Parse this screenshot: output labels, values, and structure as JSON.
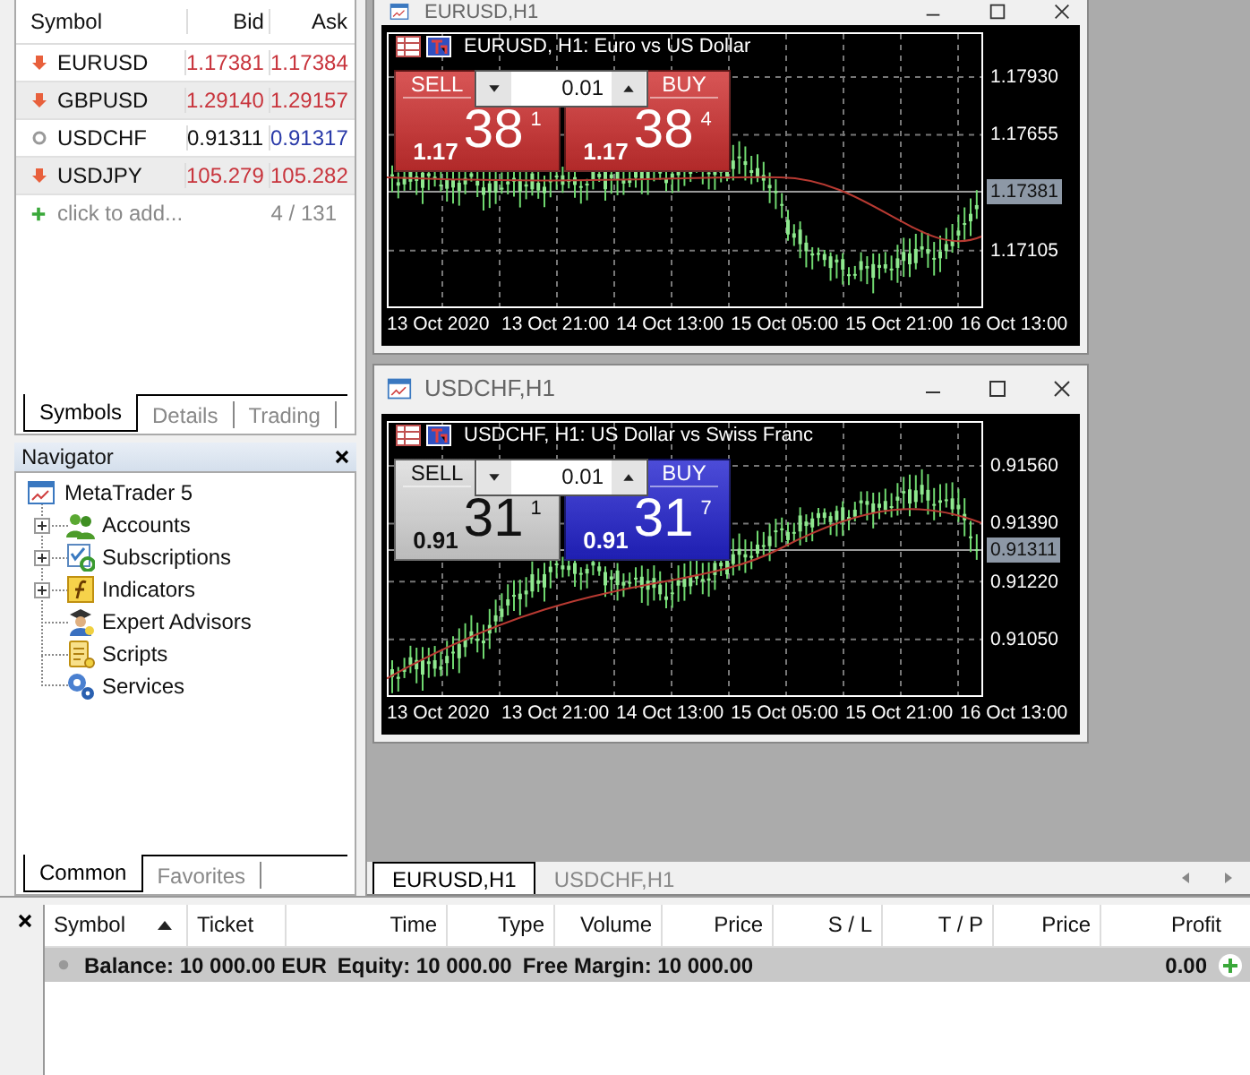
{
  "market_watch": {
    "columns": [
      "Symbol",
      "Bid",
      "Ask"
    ],
    "rows": [
      {
        "symbol": "EURUSD",
        "falling": true,
        "bid": {
          "value": "1.17381",
          "color": "#c8343c"
        },
        "ask": {
          "value": "1.17384",
          "color": "#c8343c"
        }
      },
      {
        "symbol": "GBPUSD",
        "falling": true,
        "bid": {
          "value": "1.29140",
          "color": "#c8343c"
        },
        "ask": {
          "value": "1.29157",
          "color": "#c8343c"
        }
      },
      {
        "symbol": "USDCHF",
        "falling": false,
        "bid": {
          "value": "0.91311",
          "color": "#111111"
        },
        "ask": {
          "value": "0.91317",
          "color": "#2a3aa8"
        }
      },
      {
        "symbol": "USDJPY",
        "falling": true,
        "bid": {
          "value": "105.279",
          "color": "#c8343c"
        },
        "ask": {
          "value": "105.282",
          "color": "#c8343c"
        }
      }
    ],
    "add_row": {
      "label": "click to add...",
      "count": "4 / 131"
    },
    "tabs": [
      {
        "label": "Symbols",
        "selected": true
      },
      {
        "label": "Details",
        "selected": false
      },
      {
        "label": "Trading",
        "selected": false
      }
    ]
  },
  "navigator": {
    "title": "Navigator",
    "root": {
      "label": "MetaTrader 5",
      "children": [
        {
          "label": "Accounts",
          "kind": "accounts",
          "expanded": false
        },
        {
          "label": "Subscriptions",
          "kind": "subscriptions",
          "expanded": false
        },
        {
          "label": "Indicators",
          "kind": "indicators",
          "expanded": false
        },
        {
          "label": "Expert Advisors",
          "kind": "experts"
        },
        {
          "label": "Scripts",
          "kind": "scripts"
        },
        {
          "label": "Services",
          "kind": "services"
        }
      ]
    },
    "tabs": [
      {
        "label": "Common",
        "selected": true
      },
      {
        "label": "Favorites",
        "selected": false
      }
    ]
  },
  "chart_windows": [
    {
      "title": "EURUSD,H1",
      "header": "EURUSD, H1:  Euro vs US Dollar",
      "lot": "0.01",
      "sell": {
        "label": "SELL",
        "color": "#d03030",
        "prefix": "1.17",
        "pips": "38",
        "fraction": "1"
      },
      "buy": {
        "label": "BUY",
        "color": "#d03030",
        "prefix": "1.17",
        "pips": "38",
        "fraction": "4"
      },
      "price_ticks": [
        "1.17930",
        "1.17655",
        "1.17105"
      ],
      "current_price": "1.17381",
      "time_labels": [
        "13 Oct 2020",
        "13 Oct 21:00",
        "14 Oct 13:00",
        "15 Oct 05:00",
        "15 Oct 21:00",
        "16 Oct 13:00"
      ]
    },
    {
      "title": "USDCHF,H1",
      "header": "USDCHF, H1:  US Dollar vs Swiss Franc",
      "lot": "0.01",
      "sell": {
        "label": "SELL",
        "color": "#dcdcdc",
        "prefix": "0.91",
        "pips": "31",
        "fraction": "1"
      },
      "buy": {
        "label": "BUY",
        "color": "#2424d0",
        "prefix": "0.91",
        "pips": "31",
        "fraction": "7"
      },
      "price_ticks": [
        "0.91560",
        "0.91390",
        "0.91220",
        "0.91050"
      ],
      "current_price": "0.91311",
      "time_labels": [
        "13 Oct 2020",
        "13 Oct 21:00",
        "14 Oct 13:00",
        "15 Oct 05:00",
        "15 Oct 21:00",
        "16 Oct 13:00"
      ]
    }
  ],
  "chart_tabs": [
    {
      "label": "EURUSD,H1",
      "selected": true
    },
    {
      "label": "USDCHF,H1",
      "selected": false
    }
  ],
  "toolbox": {
    "columns": [
      {
        "label": "Symbol",
        "sorted": true
      },
      {
        "label": "Ticket",
        "sorted": false
      },
      {
        "label": "Time",
        "sorted": false
      },
      {
        "label": "Type",
        "sorted": false
      },
      {
        "label": "Volume",
        "sorted": false
      },
      {
        "label": "Price",
        "sorted": false
      },
      {
        "label": "S / L",
        "sorted": false
      },
      {
        "label": "T / P",
        "sorted": false
      },
      {
        "label": "Price",
        "sorted": false
      },
      {
        "label": "Profit",
        "sorted": false
      }
    ],
    "balance_row": {
      "balance": "Balance: 10 000.00 EUR",
      "equity": "Equity: 10 000.00",
      "free_margin": "Free Margin: 10 000.00",
      "profit": "0.00"
    }
  }
}
